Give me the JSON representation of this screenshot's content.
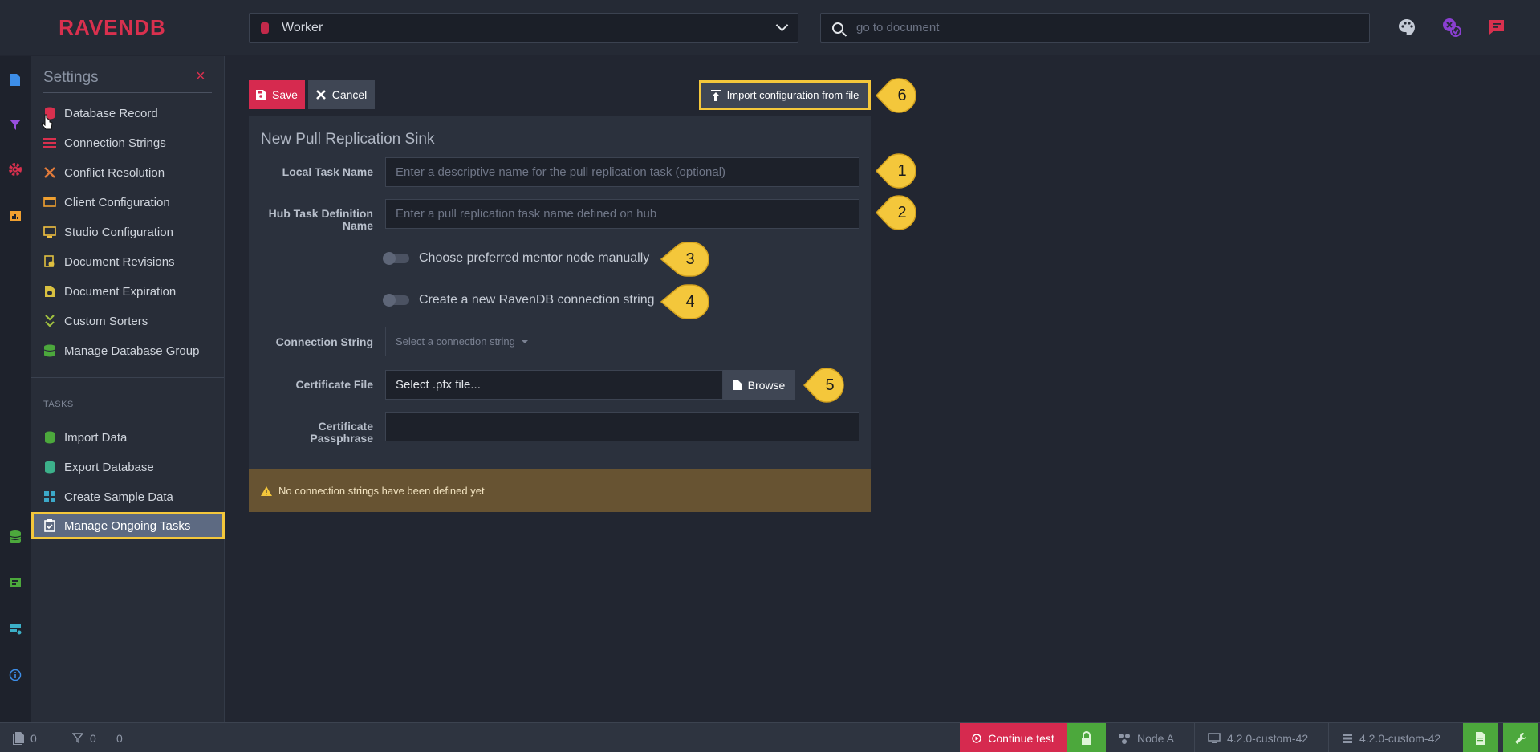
{
  "app": {
    "logo": "RAVENDB"
  },
  "header": {
    "database": "Worker",
    "search_placeholder": "go to document"
  },
  "settings_menu": {
    "title": "Settings",
    "close": "×",
    "items": [
      {
        "label": "Database Record",
        "icon": "database-record-icon",
        "color": "#d9304e"
      },
      {
        "label": "Connection Strings",
        "icon": "connection-strings-icon",
        "color": "#d9304e"
      },
      {
        "label": "Conflict Resolution",
        "icon": "conflict-icon",
        "color": "#e07a3a"
      },
      {
        "label": "Client Configuration",
        "icon": "client-config-icon",
        "color": "#f0a030"
      },
      {
        "label": "Studio Configuration",
        "icon": "studio-config-icon",
        "color": "#f0c040"
      },
      {
        "label": "Document Revisions",
        "icon": "revisions-icon",
        "color": "#e0c040"
      },
      {
        "label": "Document Expiration",
        "icon": "expiration-icon",
        "color": "#d8c040"
      },
      {
        "label": "Custom Sorters",
        "icon": "sorters-icon",
        "color": "#a0c040"
      },
      {
        "label": "Manage Database Group",
        "icon": "db-group-icon",
        "color": "#4ca83c"
      }
    ],
    "tasks_heading": "TASKS",
    "tasks": [
      {
        "label": "Import Data",
        "icon": "import-icon",
        "color": "#4ca83c"
      },
      {
        "label": "Export Database",
        "icon": "export-icon",
        "color": "#3cb08a"
      },
      {
        "label": "Create Sample Data",
        "icon": "sample-data-icon",
        "color": "#3ca8c8"
      },
      {
        "label": "Manage Ongoing Tasks",
        "icon": "ongoing-tasks-icon",
        "color": "#ffffff",
        "active": true
      }
    ]
  },
  "toolbar": {
    "save": "Save",
    "cancel": "Cancel",
    "import": "Import configuration from file"
  },
  "form": {
    "title": "New Pull Replication Sink",
    "local_task_label": "Local Task Name",
    "local_task_placeholder": "Enter a descriptive name for the pull replication task (optional)",
    "hub_task_label": "Hub Task Definition Name",
    "hub_task_placeholder": "Enter a pull replication task name defined on hub",
    "mentor_toggle": "Choose preferred mentor node manually",
    "new_cs_toggle": "Create a new RavenDB connection string",
    "connection_string_label": "Connection String",
    "connection_string_placeholder": "Select a connection string",
    "certificate_label": "Certificate File",
    "certificate_value": "Select .pfx file...",
    "browse": "Browse",
    "passphrase_label": "Certificate Passphrase",
    "warning": "No connection strings have been defined yet"
  },
  "callouts": [
    "1",
    "2",
    "3",
    "4",
    "5",
    "6"
  ],
  "statusbar": {
    "docs_count": "0",
    "indexes_count": "0",
    "errors_count": "0",
    "continue_test": "Continue test",
    "node": "Node A",
    "client_version": "4.2.0-custom-42",
    "server_version": "4.2.0-custom-42"
  },
  "colors": {
    "accent": "#d62a4f",
    "highlight": "#f4c73b",
    "success": "#4ca83c",
    "warning_bg": "#675332"
  }
}
